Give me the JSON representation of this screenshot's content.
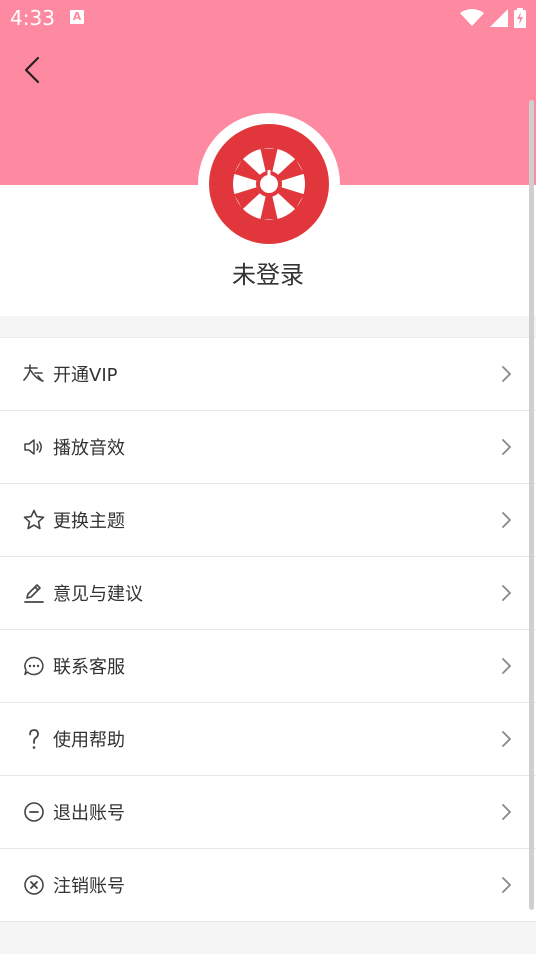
{
  "status_bar": {
    "time": "4:33",
    "notification_glyph": "A",
    "icons": [
      "wifi-icon",
      "signal-icon",
      "battery-charging-icon"
    ]
  },
  "header": {
    "back_icon": "chevron-left-icon",
    "avatar_icon": "app-logo-wheel",
    "login_status": "未登录"
  },
  "colors": {
    "header_pink": "#fe8aa2",
    "avatar_red": "#e1373c",
    "text": "#333333",
    "icon": "#444444",
    "chevron": "#888888"
  },
  "menu": [
    {
      "label": "开通VIP",
      "icon": "vip-icon"
    },
    {
      "label": "播放音效",
      "icon": "speaker-icon"
    },
    {
      "label": "更换主题",
      "icon": "star-icon"
    },
    {
      "label": "意见与建议",
      "icon": "edit-icon"
    },
    {
      "label": "联系客服",
      "icon": "chat-icon"
    },
    {
      "label": "使用帮助",
      "icon": "question-icon"
    },
    {
      "label": "退出账号",
      "icon": "minus-circle-icon"
    },
    {
      "label": "注销账号",
      "icon": "close-circle-icon"
    }
  ]
}
